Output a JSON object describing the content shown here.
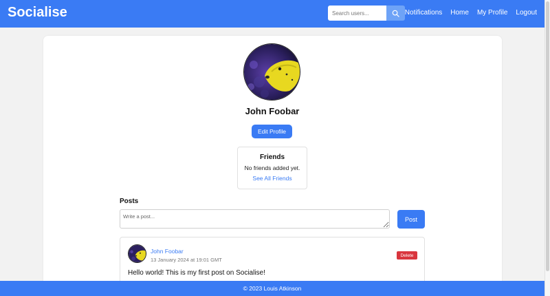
{
  "navbar": {
    "brand": "Socialise",
    "search": {
      "placeholder": "Search users..."
    },
    "links": [
      "Notifications",
      "Home",
      "My Profile",
      "Logout"
    ],
    "accent_color": "#3a7bf4"
  },
  "profile": {
    "name": "John Foobar",
    "edit_button": "Edit Profile",
    "avatar_icon": "yellow-fish-avatar"
  },
  "friends": {
    "title": "Friends",
    "empty_text": "No friends added yet.",
    "link": "See All Friends"
  },
  "posts": {
    "heading": "Posts",
    "composer": {
      "placeholder": "Write a post...",
      "button": "Post"
    },
    "items": [
      {
        "author": "John Foobar",
        "timestamp": "13 January 2024 at 19:01 GMT",
        "delete_label": "Delete",
        "content": "Hello world! This is my first post on Socialise!"
      }
    ]
  },
  "footer": {
    "text": "© 2023 Louis Atkinson"
  }
}
